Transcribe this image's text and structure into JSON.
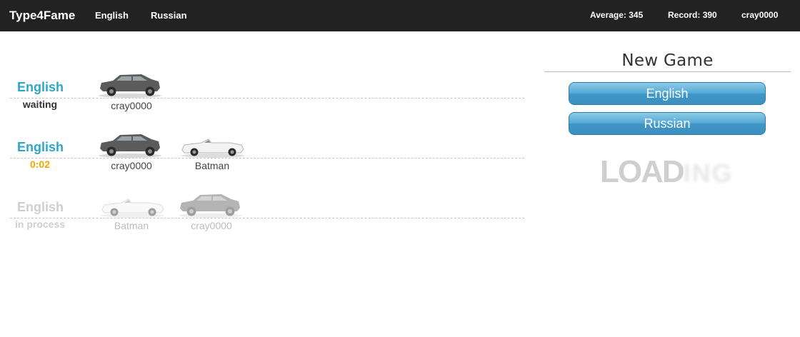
{
  "nav": {
    "brand": "Type4Fame",
    "links": [
      "English",
      "Russian"
    ],
    "average_label": "Average: ",
    "average_value": "345",
    "record_label": "Record: ",
    "record_value": "390",
    "user": "cray0000"
  },
  "races": [
    {
      "language": "English",
      "status": "waiting",
      "players": [
        {
          "name": "cray0000",
          "car": "suv-dark-gray"
        }
      ]
    },
    {
      "language": "English",
      "status": "0:02",
      "players": [
        {
          "name": "cray0000",
          "car": "suv-dark-gray"
        },
        {
          "name": "Batman",
          "car": "convertible-white"
        }
      ]
    },
    {
      "language": "English",
      "status": "in process",
      "players": [
        {
          "name": "Batman",
          "car": "convertible-white"
        },
        {
          "name": "cray0000",
          "car": "suv-dark-gray"
        }
      ]
    }
  ],
  "new_game": {
    "title": "New Game",
    "buttons": [
      "English",
      "Russian"
    ]
  },
  "loading": {
    "solid": "LOAD",
    "faded": "ING"
  },
  "colors": {
    "navbar": "#222222",
    "accent_blue": "#2ea6c9",
    "timer": "#f0a900",
    "button_blue": "#4ba2d0"
  }
}
